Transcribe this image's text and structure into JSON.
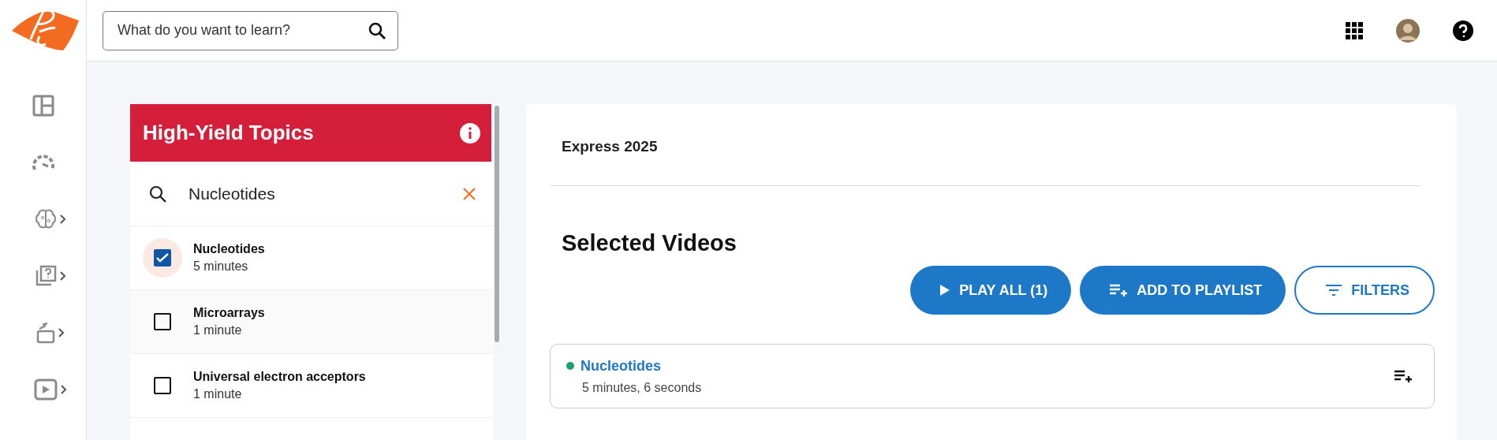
{
  "search": {
    "placeholder": "What do you want to learn?"
  },
  "sidebar": {
    "items": [
      {
        "kind": "plain"
      },
      {
        "kind": "plain"
      },
      {
        "kind": "menu"
      },
      {
        "kind": "menu"
      },
      {
        "kind": "menu"
      },
      {
        "kind": "menu"
      }
    ]
  },
  "topics": {
    "title": "High-Yield Topics",
    "search_value": "Nucleotides",
    "items": [
      {
        "name": "Nucleotides",
        "duration": "5 minutes",
        "checked": true
      },
      {
        "name": "Microarrays",
        "duration": "1 minute",
        "checked": false
      },
      {
        "name": "Universal electron acceptors",
        "duration": "1 minute",
        "checked": false
      }
    ]
  },
  "main": {
    "course": "Express 2025",
    "heading": "Selected Videos",
    "buttons": [
      {
        "kind": "play",
        "label": "PLAY ALL (1)"
      },
      {
        "kind": "playlist",
        "label": "ADD TO PLAYLIST"
      },
      {
        "kind": "filters",
        "label": "FILTERS"
      }
    ],
    "videos": [
      {
        "title": "Nucleotides",
        "duration": "5 minutes, 6 seconds",
        "color": "#1aa06d"
      }
    ]
  }
}
